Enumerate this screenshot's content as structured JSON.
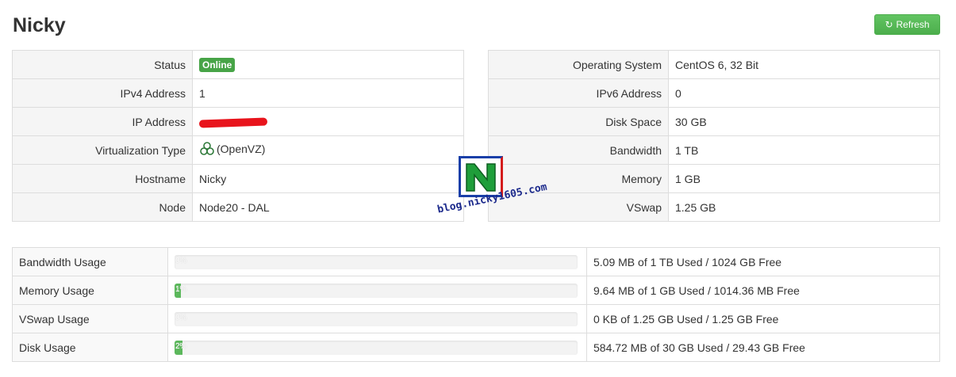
{
  "header": {
    "title": "Nicky",
    "refresh_label": "Refresh"
  },
  "left_info": [
    {
      "key": "Status",
      "value": "Online",
      "type": "badge"
    },
    {
      "key": "IPv4 Address",
      "value": "1"
    },
    {
      "key": "IP Address",
      "value": "",
      "type": "redacted"
    },
    {
      "key": "Virtualization Type",
      "value": "(OpenVZ)",
      "type": "icon"
    },
    {
      "key": "Hostname",
      "value": "Nicky"
    },
    {
      "key": "Node",
      "value": "Node20 - DAL"
    }
  ],
  "right_info": [
    {
      "key": "Operating System",
      "value": "CentOS 6, 32 Bit"
    },
    {
      "key": "IPv6 Address",
      "value": "0"
    },
    {
      "key": "Disk Space",
      "value": "30 GB"
    },
    {
      "key": "Bandwidth",
      "value": "1 TB"
    },
    {
      "key": "Memory",
      "value": "1 GB"
    },
    {
      "key": "VSwap",
      "value": "1.25 GB"
    }
  ],
  "usage": [
    {
      "label": "Bandwidth Usage",
      "percent": 0,
      "percent_label": "0%",
      "detail": "5.09 MB of 1 TB Used / 1024 GB Free"
    },
    {
      "label": "Memory Usage",
      "percent": 1,
      "percent_label": "1%",
      "detail": "9.64 MB of 1 GB Used / 1014.36 MB Free"
    },
    {
      "label": "VSwap Usage",
      "percent": 0,
      "percent_label": "0%",
      "detail": "0 KB of 1.25 GB Used / 1.25 GB Free"
    },
    {
      "label": "Disk Usage",
      "percent": 2,
      "percent_label": "2%",
      "detail": "584.72 MB of 30 GB Used / 29.43 GB Free"
    }
  ],
  "watermark": {
    "letter": "N",
    "text": "blog.nicky1605.com"
  },
  "colors": {
    "accent_green": "#5cb85c",
    "badge_green": "#47a447",
    "redaction": "#e8141c"
  }
}
